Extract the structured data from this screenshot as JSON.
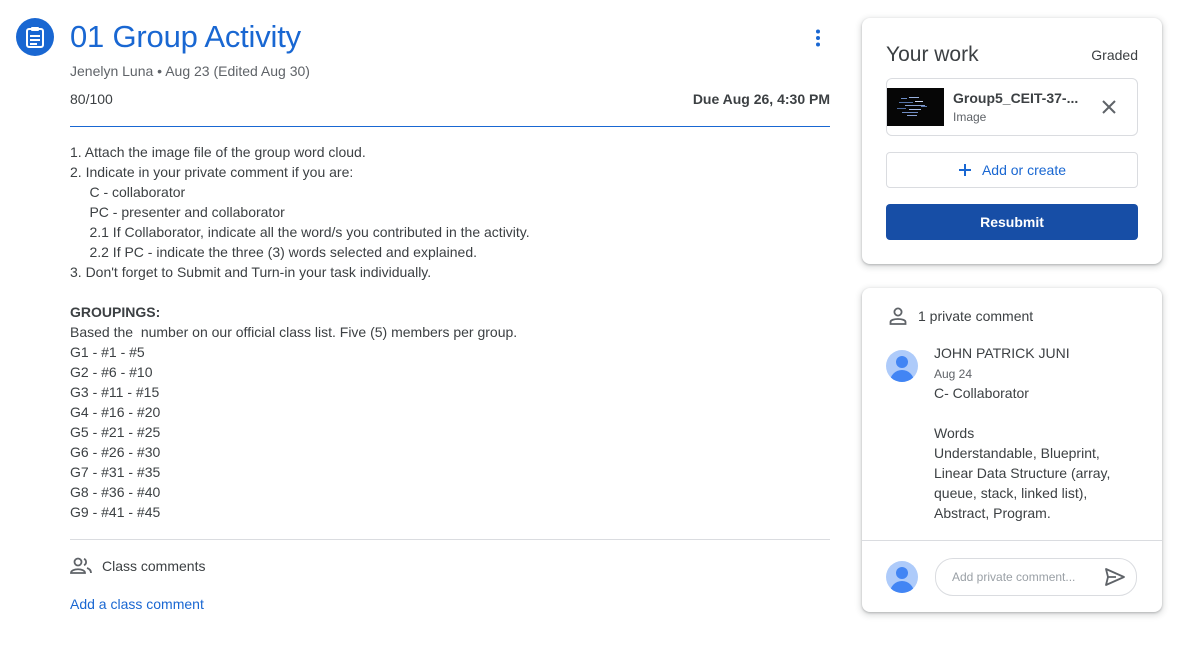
{
  "assignment": {
    "title": "01 Group Activity",
    "meta": "Jenelyn Luna • Aug 23 (Edited Aug 30)",
    "points_earned": "80",
    "points_total": "/100",
    "due": "Due Aug 26, 4:30 PM",
    "instructions": [
      "1. Attach the image file of the group word cloud.",
      "2. Indicate in your private comment if you are:",
      "     C - collaborator",
      "     PC - presenter and collaborator",
      "     2.1 If Collaborator, indicate all the word/s you contributed in the activity.",
      "     2.2 If PC - indicate the three (3) words selected and explained.",
      "3. Don't forget to Submit and Turn-in your task individually.",
      "",
      "GROUPINGS:",
      "Based the  number on our official class list. Five (5) members per group.",
      "G1 - #1 - #5",
      "G2 - #6 - #10",
      "G3 - #11 - #15",
      "G4 - #16 - #20",
      "G5 - #21 - #25",
      "G6 - #26 - #30",
      "G7 - #31 - #35",
      "G8 - #36 - #40",
      "G9 - #41 - #45"
    ]
  },
  "class_comments": {
    "label": "Class comments",
    "add_link": "Add a class comment"
  },
  "your_work": {
    "title": "Your work",
    "status": "Graded",
    "attachment": {
      "name": "Group5_CEIT-37-...",
      "type": "Image"
    },
    "add_create": "Add or create",
    "resubmit": "Resubmit"
  },
  "private_comments": {
    "header": "1 private comment",
    "comment": {
      "author": "JOHN PATRICK JUNI",
      "date": "Aug 24",
      "lines": [
        "C- Collaborator",
        "",
        "Words",
        "Understandable, Blueprint,",
        "Linear Data Structure (array,",
        "queue, stack, linked list),",
        "Abstract, Program."
      ]
    },
    "input_placeholder": "Add private comment..."
  },
  "colors": {
    "primary": "#1967d2",
    "button": "#174ea6",
    "text": "#3c4043",
    "muted": "#5f6368"
  },
  "icons": [
    "assignment-icon",
    "more-vert-icon",
    "people-icon",
    "close-icon",
    "plus-icon",
    "person-icon",
    "send-icon"
  ]
}
